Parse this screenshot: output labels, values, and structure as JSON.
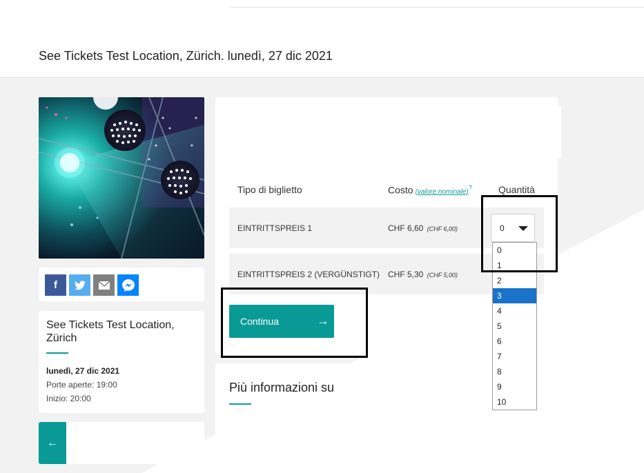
{
  "header": {
    "event_line": "See Tickets Test Location, Zürich. lunedì, 27 dic 2021"
  },
  "share": {
    "facebook_icon": "f",
    "twitter_icon": "🐦",
    "mail_icon": "✉",
    "messenger_icon": "messenger"
  },
  "info": {
    "venue": "See Tickets Test Location, Zürich",
    "date": "lunedì, 27 dic 2021",
    "doors": "Porte aperte: 19:00",
    "start": "Inizio: 20:00"
  },
  "back": {
    "icon": "←"
  },
  "tickets": {
    "col_type": "Tipo di biglietto",
    "col_cost": "Costo",
    "col_cost_note": "(valore nominale)",
    "col_cost_sup": "?",
    "col_qty": "Quantità",
    "rows": [
      {
        "name": "EINTRITTSPREIS 1",
        "price": "CHF 6,60",
        "face": "(CHF 6,00)",
        "qty": "0"
      },
      {
        "name": "EINTRITTSPREIS 2 (VERGÜNSTIGT)",
        "price": "CHF 5,30",
        "face": "(CHF 5,00)"
      }
    ],
    "continue_label": "Continua",
    "continue_icon": "→"
  },
  "more": {
    "title": "Più informazioni su '"
  },
  "dropdown": {
    "options": [
      "0",
      "1",
      "2",
      "3",
      "4",
      "5",
      "6",
      "7",
      "8",
      "9",
      "10"
    ],
    "selected_index": 3
  },
  "colors": {
    "accent": "#0a9a96",
    "selected": "#1a73c8"
  }
}
